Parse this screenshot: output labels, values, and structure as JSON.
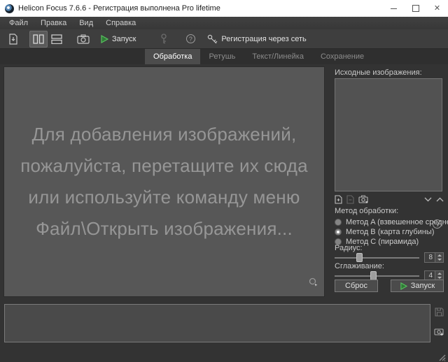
{
  "window": {
    "title": "Helicon Focus 7.6.6 - Регистрация выполнена Pro lifetime",
    "close_glyph": "✕"
  },
  "menu": {
    "items": [
      {
        "label": "Файл"
      },
      {
        "label": "Правка"
      },
      {
        "label": "Вид"
      },
      {
        "label": "Справка"
      }
    ]
  },
  "toolbar": {
    "run_label": "Запуск",
    "registration_label": "Регистрация через сеть",
    "help_glyph": "?"
  },
  "tabs": {
    "items": [
      {
        "label": "Обработка",
        "active": true
      },
      {
        "label": "Ретушь",
        "active": false
      },
      {
        "label": "Текст/Линейка",
        "active": false
      },
      {
        "label": "Сохранение",
        "active": false
      }
    ]
  },
  "dropzone": {
    "lines": [
      "Для добавления изображений,",
      "пожалуйста, перетащите их сюда",
      "или используйте команду меню",
      "Файл\\Открыть изображения..."
    ]
  },
  "source_panel": {
    "title": "Исходные изображения:",
    "method": {
      "label": "Метод обработки:",
      "help_glyph": "?",
      "options": [
        {
          "label": "Метод A (взвешенное среднее)",
          "selected": false
        },
        {
          "label": "Метод B (карта глубины)",
          "selected": true
        },
        {
          "label": "Метод C (пирамида)",
          "selected": false
        }
      ]
    },
    "radius": {
      "label": "Радиус:",
      "value": "8"
    },
    "smoothing": {
      "label": "Сглаживание:",
      "value": "4"
    },
    "reset_label": "Сброс",
    "run_label": "Запуск"
  },
  "colors": {
    "accent_green": "#45b04d",
    "titlebar_bg": "#ffffff",
    "chrome_bg": "#3e3e3e",
    "panel_bg": "#333333",
    "dropzone_bg": "#575757",
    "dropzone_text": "#969696"
  }
}
